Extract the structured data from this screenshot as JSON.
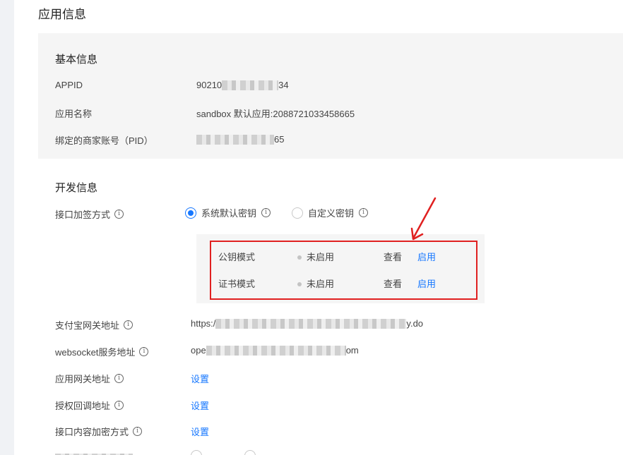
{
  "page": {
    "title": "应用信息"
  },
  "basic": {
    "title": "基本信息",
    "rows": [
      {
        "label": "APPID",
        "value_prefix": "90210",
        "value_suffix": "34"
      },
      {
        "label": "应用名称",
        "value": "sandbox 默认应用:2088721033458665"
      },
      {
        "label": "绑定的商家账号（PID）",
        "value_suffix": "65"
      }
    ]
  },
  "dev": {
    "title": "开发信息",
    "sign_method": {
      "label": "接口加签方式",
      "options": [
        {
          "label": "系统默认密钥",
          "checked": true
        },
        {
          "label": "自定义密钥",
          "checked": false
        }
      ]
    },
    "modes": [
      {
        "name": "公钥模式",
        "status": "未启用",
        "view": "查看",
        "action": "启用"
      },
      {
        "name": "证书模式",
        "status": "未启用",
        "view": "查看",
        "action": "启用"
      }
    ],
    "rows": [
      {
        "label": "支付宝网关地址",
        "value_prefix": "https:/",
        "value_suffix": "y.do"
      },
      {
        "label": "websocket服务地址",
        "value_prefix": "ope",
        "value_suffix": "om"
      },
      {
        "label": "应用网关地址",
        "link": "设置"
      },
      {
        "label": "授权回调地址",
        "link": "设置"
      },
      {
        "label": "接口内容加密方式",
        "link": "设置"
      }
    ]
  },
  "colors": {
    "accent": "#1677ff",
    "highlight": "#e02020",
    "card_bg": "#f5f5f5"
  }
}
